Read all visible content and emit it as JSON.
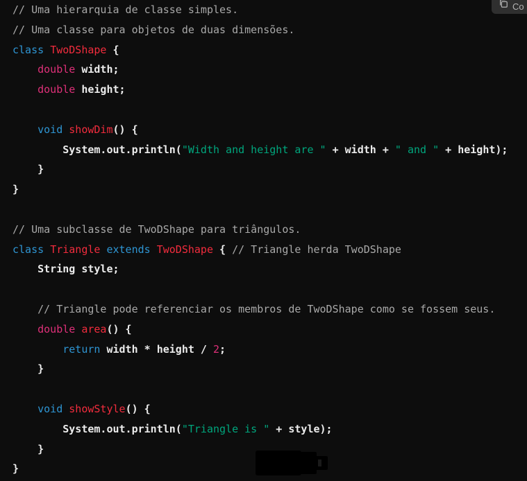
{
  "toolbar": {
    "copy_label": "Co",
    "copy_icon": "copy-icon"
  },
  "code": {
    "language": "java",
    "lines": [
      [
        {
          "t": "comment",
          "v": "// Uma hierarquia de classe simples."
        }
      ],
      [
        {
          "t": "comment",
          "v": "// Uma classe para objetos de duas dimensões."
        }
      ],
      [
        {
          "t": "keyword",
          "v": "class"
        },
        {
          "t": "plain",
          "v": " "
        },
        {
          "t": "class",
          "v": "TwoDShape"
        },
        {
          "t": "plain",
          "v": " {"
        }
      ],
      [
        {
          "t": "plain",
          "v": "    "
        },
        {
          "t": "type",
          "v": "double"
        },
        {
          "t": "plain",
          "v": " width;"
        }
      ],
      [
        {
          "t": "plain",
          "v": "    "
        },
        {
          "t": "type",
          "v": "double"
        },
        {
          "t": "plain",
          "v": " height;"
        }
      ],
      [],
      [
        {
          "t": "plain",
          "v": "    "
        },
        {
          "t": "keyword",
          "v": "void"
        },
        {
          "t": "plain",
          "v": " "
        },
        {
          "t": "func",
          "v": "showDim"
        },
        {
          "t": "plain",
          "v": "() {"
        }
      ],
      [
        {
          "t": "plain",
          "v": "        System.out.println("
        },
        {
          "t": "string",
          "v": "\"Width and height are \""
        },
        {
          "t": "plain",
          "v": " + width + "
        },
        {
          "t": "string",
          "v": "\" and \""
        },
        {
          "t": "plain",
          "v": " + height);"
        }
      ],
      [
        {
          "t": "plain",
          "v": "    }"
        }
      ],
      [
        {
          "t": "plain",
          "v": "}"
        }
      ],
      [],
      [
        {
          "t": "comment",
          "v": "// Uma subclasse de TwoDShape para triângulos."
        }
      ],
      [
        {
          "t": "keyword",
          "v": "class"
        },
        {
          "t": "plain",
          "v": " "
        },
        {
          "t": "class",
          "v": "Triangle"
        },
        {
          "t": "plain",
          "v": " "
        },
        {
          "t": "keyword",
          "v": "extends"
        },
        {
          "t": "plain",
          "v": " "
        },
        {
          "t": "class",
          "v": "TwoDShape"
        },
        {
          "t": "plain",
          "v": " { "
        },
        {
          "t": "comment",
          "v": "// Triangle herda TwoDShape"
        }
      ],
      [
        {
          "t": "plain",
          "v": "    String style;"
        }
      ],
      [],
      [
        {
          "t": "plain",
          "v": "    "
        },
        {
          "t": "comment",
          "v": "// Triangle pode referenciar os membros de TwoDShape como se fossem seus."
        }
      ],
      [
        {
          "t": "plain",
          "v": "    "
        },
        {
          "t": "type",
          "v": "double"
        },
        {
          "t": "plain",
          "v": " "
        },
        {
          "t": "func",
          "v": "area"
        },
        {
          "t": "plain",
          "v": "() {"
        }
      ],
      [
        {
          "t": "plain",
          "v": "        "
        },
        {
          "t": "keyword",
          "v": "return"
        },
        {
          "t": "plain",
          "v": " width * height / "
        },
        {
          "t": "number",
          "v": "2"
        },
        {
          "t": "plain",
          "v": ";"
        }
      ],
      [
        {
          "t": "plain",
          "v": "    }"
        }
      ],
      [],
      [
        {
          "t": "plain",
          "v": "    "
        },
        {
          "t": "keyword",
          "v": "void"
        },
        {
          "t": "plain",
          "v": " "
        },
        {
          "t": "func",
          "v": "showStyle"
        },
        {
          "t": "plain",
          "v": "() {"
        }
      ],
      [
        {
          "t": "plain",
          "v": "        System.out.println("
        },
        {
          "t": "string",
          "v": "\"Triangle is \""
        },
        {
          "t": "plain",
          "v": " + style);"
        }
      ],
      [
        {
          "t": "plain",
          "v": "    }"
        }
      ],
      [
        {
          "t": "plain",
          "v": "}"
        }
      ]
    ]
  },
  "colors": {
    "background": "#0d0d0d",
    "comment": "#a9a9a9",
    "keyword": "#2e95d3",
    "type": "#df3079",
    "class": "#f22c3d",
    "string": "#00a67d",
    "plain": "#ececec"
  }
}
